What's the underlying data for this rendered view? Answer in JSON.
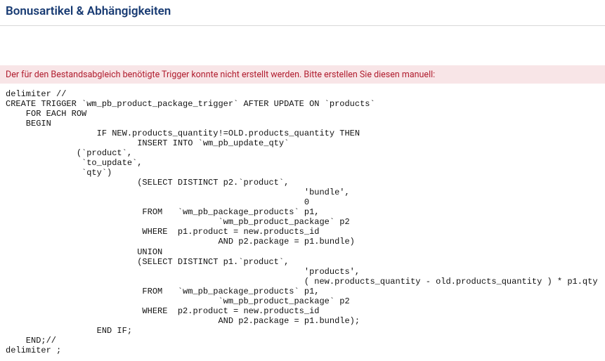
{
  "header": {
    "title": "Bonusartikel & Abhängigkeiten"
  },
  "alert": {
    "message": "Der für den Bestandsabgleich benötigte Trigger konnte nicht erstellt werden. Bitte erstellen Sie diesen manuell:"
  },
  "code": "delimiter //\nCREATE TRIGGER `wm_pb_product_package_trigger` AFTER UPDATE ON `products`\n    FOR EACH ROW\n    BEGIN\n                  IF NEW.products_quantity!=OLD.products_quantity THEN\n                          INSERT INTO `wm_pb_update_qty`\n              (`product`,\n               `to_update`,\n               `qty`)\n                          (SELECT DISTINCT p2.`product`,\n                                                           'bundle',\n                                                           0\n                           FROM   `wm_pb_package_products` p1,\n                                          `wm_pb_product_package` p2\n                           WHERE  p1.product = new.products_id\n                                          AND p2.package = p1.bundle)\n                          UNION\n                          (SELECT DISTINCT p1.`product`,\n                                                           'products',\n                                                           ( new.products_quantity - old.products_quantity ) * p1.qty\n                           FROM   `wm_pb_package_products` p1,\n                                          `wm_pb_product_package` p2\n                           WHERE  p2.product = new.products_id\n                                          AND p2.package = p1.bundle);\n                  END IF;\n    END;//\ndelimiter ;"
}
